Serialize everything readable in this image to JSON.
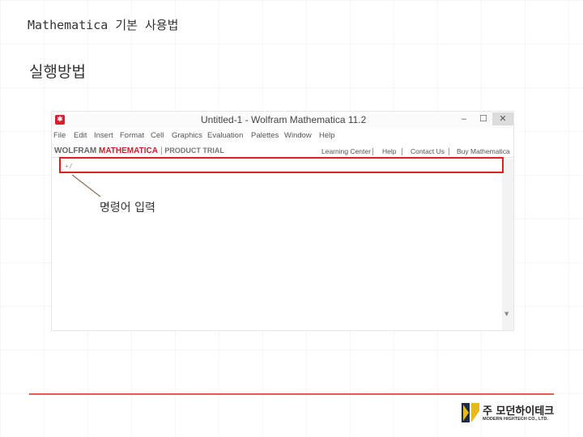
{
  "slide": {
    "title": "Mathematica 기본 사용법",
    "section": "실행방법",
    "callout": "명령어 입력"
  },
  "window": {
    "title": "Untitled-1 - Wolfram Mathematica 11.2",
    "controls": {
      "minimize": "–",
      "maximize": "☐",
      "close": "✕"
    },
    "menu": [
      "File",
      "Edit",
      "Insert",
      "Format",
      "Cell",
      "Graphics",
      "Evaluation",
      "Palettes",
      "Window",
      "Help"
    ],
    "brand": {
      "wolfram": "WOLFRAM",
      "mathematica": "MATHEMATICA",
      "trial": "PRODUCT TRIAL"
    },
    "links": [
      "Learning Center",
      "Help",
      "Contact Us",
      "Buy Mathematica"
    ],
    "input_prompt": "+/"
  },
  "company": {
    "name": "주 모던하이테크",
    "english": "MODERN HIGHTECH CO., LTD."
  },
  "colors": {
    "highlight": "#e0201f",
    "mathematica_red": "#c8202c",
    "logo_navy": "#1f2a44",
    "logo_gold": "#e8b820"
  }
}
